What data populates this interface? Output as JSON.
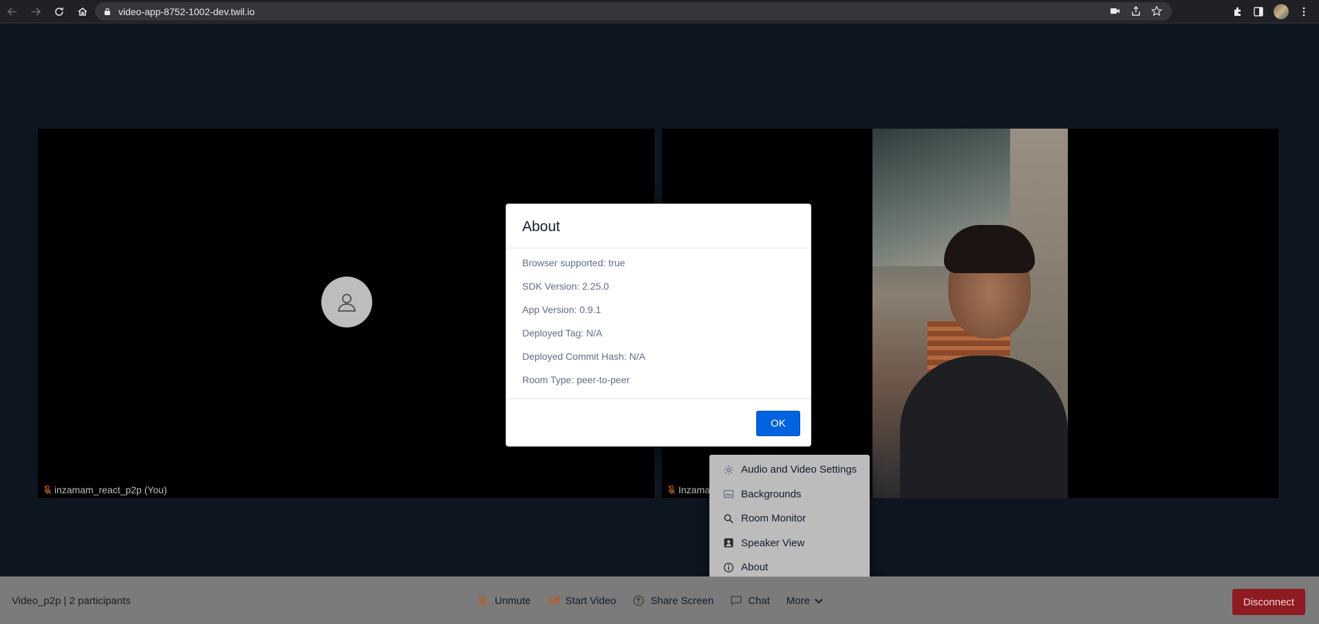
{
  "browser": {
    "url": "video-app-8752-1002-dev.twil.io",
    "icons": [
      "back-icon",
      "forward-icon",
      "reload-icon",
      "home-icon",
      "lock-icon",
      "camera-blocked-icon",
      "share-icon",
      "star-icon",
      "extensions-icon",
      "sidepanel-icon",
      "profile-avatar",
      "kebab-menu-icon"
    ]
  },
  "tiles": {
    "local": {
      "label": "inzamam_react_p2p (You)"
    },
    "remote": {
      "label": "Inzama"
    }
  },
  "dialog": {
    "title": "About",
    "rows": [
      "Browser supported: true",
      "SDK Version: 2.25.0",
      "App Version: 0.9.1",
      "Deployed Tag: N/A",
      "Deployed Commit Hash: N/A",
      "Room Type: peer-to-peer"
    ],
    "ok_label": "OK"
  },
  "menu": {
    "items": [
      {
        "label": "Audio and Video Settings",
        "icon": "gear-icon"
      },
      {
        "label": "Backgrounds",
        "icon": "image-icon"
      },
      {
        "label": "Room Monitor",
        "icon": "search-icon"
      },
      {
        "label": "Speaker View",
        "icon": "person-box-icon"
      },
      {
        "label": "About",
        "icon": "info-icon"
      }
    ]
  },
  "bottombar": {
    "room_info": "Video_p2p | 2 participants",
    "unmute": "Unmute",
    "start_video": "Start Video",
    "share_screen": "Share Screen",
    "chat": "Chat",
    "more": "More",
    "disconnect": "Disconnect"
  },
  "colors": {
    "ok_button": "#0263e0",
    "disconnect": "#8e1b22",
    "mic_muted": "#c05a1f"
  }
}
